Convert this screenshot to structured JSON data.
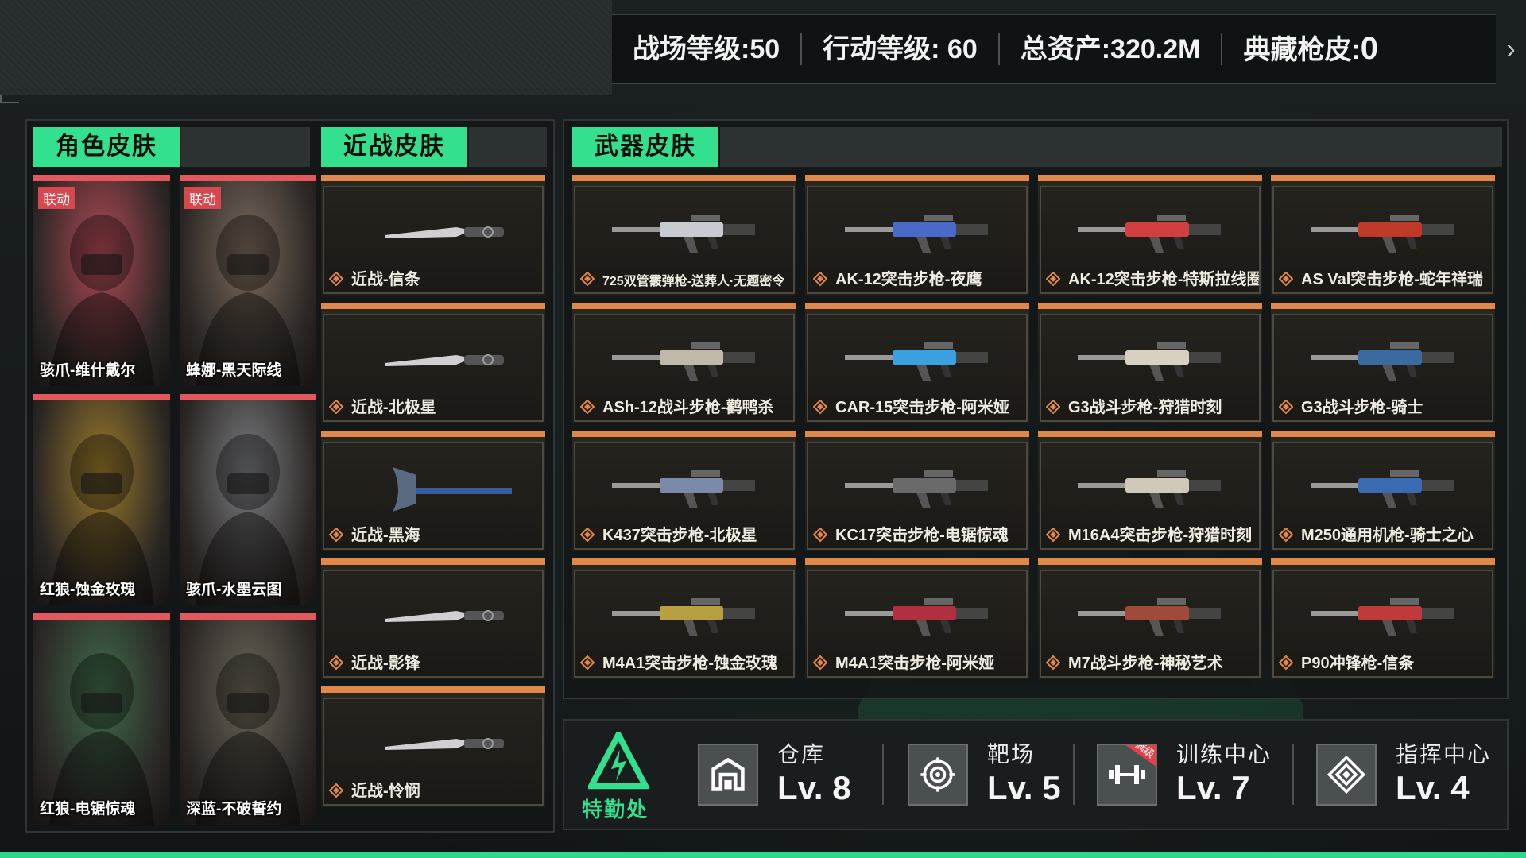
{
  "stats": {
    "battlefield_level": "战场等级:50",
    "operation_level": "行动等级: 60",
    "total_assets": "总资产:320.2M",
    "collection_skins_label": "典藏枪皮:",
    "collection_skins_value": "0"
  },
  "tabs": {
    "character": "角色皮肤",
    "melee": "近战皮肤",
    "weapon": "武器皮肤"
  },
  "characters": [
    {
      "name": "骇爪-维什戴尔",
      "badge": "联动",
      "color": "#b04a55"
    },
    {
      "name": "蜂娜-黑天际线",
      "badge": "联动",
      "color": "#7a6a5c"
    },
    {
      "name": "红狼-蚀金玫瑰",
      "badge": "",
      "color": "#9a7a2a"
    },
    {
      "name": "骇爪-水墨云图",
      "badge": "",
      "color": "#7a7c80"
    },
    {
      "name": "红狼-电锯惊魂",
      "badge": "",
      "color": "#3f6a4a"
    },
    {
      "name": "深蓝-不破誓约",
      "badge": "",
      "color": "#6a6458"
    }
  ],
  "melee": [
    {
      "name": "近战-信条",
      "icon": "knife-icon"
    },
    {
      "name": "近战-北极星",
      "icon": "knife-icon"
    },
    {
      "name": "近战-黑海",
      "icon": "axe-icon"
    },
    {
      "name": "近战-影锋",
      "icon": "knife-icon"
    },
    {
      "name": "近战-怜悯",
      "icon": "knife-icon"
    }
  ],
  "weapons": [
    {
      "name": "725双管霰弹枪-送葬人·无题密令",
      "accent": "#c8ccd0"
    },
    {
      "name": "AK-12突击步枪-夜鹰",
      "accent": "#4a6ac8"
    },
    {
      "name": "AK-12突击步枪-特斯拉线圈",
      "accent": "#d04040"
    },
    {
      "name": "AS Val突击步枪-蛇年祥瑞",
      "accent": "#c03a2a"
    },
    {
      "name": "ASh-12战斗步枪-鹳鸭杀",
      "accent": "#c0b8a8"
    },
    {
      "name": "CAR-15突击步枪-阿米娅",
      "accent": "#3aa0e0"
    },
    {
      "name": "G3战斗步枪-狩猎时刻",
      "accent": "#d8d0c0"
    },
    {
      "name": "G3战斗步枪-骑士",
      "accent": "#3a6aa0"
    },
    {
      "name": "K437突击步枪-北极星",
      "accent": "#7a8aa8"
    },
    {
      "name": "KC17突击步枪-电锯惊魂",
      "accent": "#6a6a6a"
    },
    {
      "name": "M16A4突击步枪-狩猎时刻",
      "accent": "#d0c8b8"
    },
    {
      "name": "M250通用机枪-骑士之心",
      "accent": "#3a6ab0"
    },
    {
      "name": "M4A1突击步枪-蚀金玫瑰",
      "accent": "#b8a040"
    },
    {
      "name": "M4A1突击步枪-阿米娅",
      "accent": "#b03040"
    },
    {
      "name": "M7战斗步枪-神秘艺术",
      "accent": "#a04a3a"
    },
    {
      "name": "P90冲锋枪-信条",
      "accent": "#c03a3a"
    }
  ],
  "facilities": [
    {
      "name": "仓库",
      "level": "Lv. 8",
      "icon": "warehouse-icon"
    },
    {
      "name": "靶场",
      "level": "Lv. 5",
      "icon": "target-icon"
    },
    {
      "name": "训练中心",
      "level": "Lv. 7",
      "icon": "dumbbell-icon",
      "tag": "满级"
    },
    {
      "name": "指挥中心",
      "level": "Lv. 4",
      "icon": "command-icon"
    }
  ],
  "special_office": "特勤处",
  "colors": {
    "accent_green": "#33e08d",
    "orange_stripe": "#e0884a",
    "red_stripe": "#e2585c"
  }
}
